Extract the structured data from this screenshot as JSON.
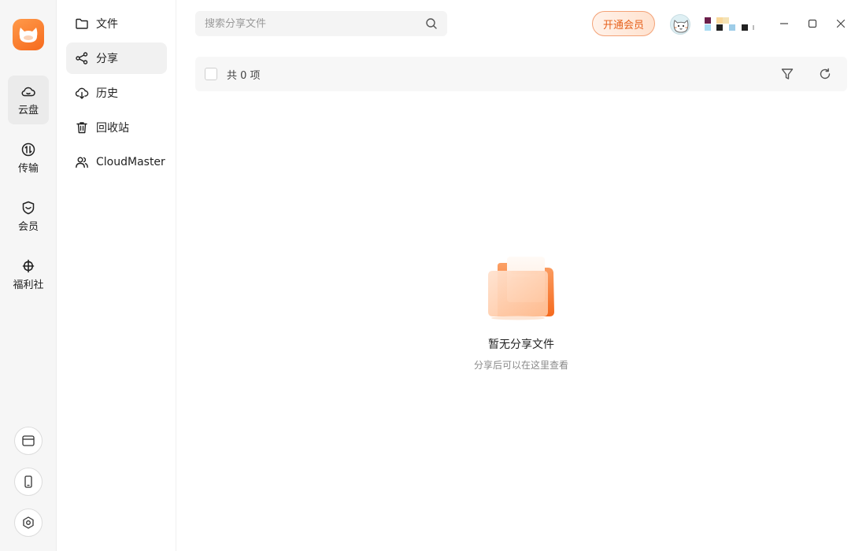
{
  "rail": {
    "items": [
      {
        "label": "云盘",
        "icon": "cloud-icon",
        "active": true
      },
      {
        "label": "传输",
        "icon": "transfer-icon",
        "active": false
      },
      {
        "label": "会员",
        "icon": "vip-shield-icon",
        "active": false
      },
      {
        "label": "福利社",
        "icon": "welfare-icon",
        "active": false
      }
    ],
    "bottom_icons": [
      "browser-window-icon",
      "phone-icon",
      "settings-hexagon-icon"
    ]
  },
  "sidebar": {
    "items": [
      {
        "label": "文件",
        "icon": "folder-icon",
        "active": false
      },
      {
        "label": "分享",
        "icon": "share-icon",
        "active": true
      },
      {
        "label": "历史",
        "icon": "history-download-icon",
        "active": false
      },
      {
        "label": "回收站",
        "icon": "trash-icon",
        "active": false
      },
      {
        "label": "CloudMaster",
        "icon": "users-icon",
        "active": false
      }
    ]
  },
  "search": {
    "placeholder": "搜索分享文件"
  },
  "header": {
    "vip_button": "开通会员"
  },
  "toolbar": {
    "count_label": "共 0 项"
  },
  "empty_state": {
    "title": "暂无分享文件",
    "subtitle": "分享后可以在这里查看"
  },
  "colors": {
    "accent": "#f66a1d",
    "vip_text": "#e6611d",
    "rail_bg": "#f6f6f6",
    "active_bg": "#ebebeb"
  }
}
